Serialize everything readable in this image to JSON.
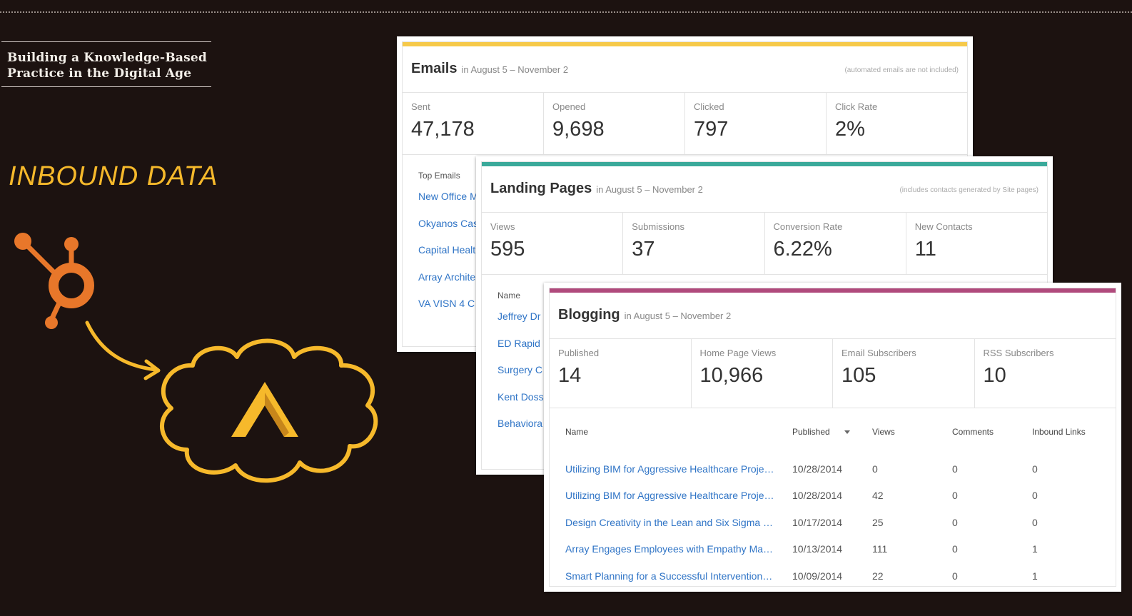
{
  "page": {
    "title_line1": "Building a Knowledge-Based",
    "title_line2": "Practice in the Digital Age",
    "heading": "INBOUND DATA"
  },
  "colors": {
    "accent_yellow": "#f6b92b",
    "hub_orange": "#e8772a",
    "emails_bar": "#f6c94a",
    "landing_bar": "#3aa99a",
    "blogging_bar": "#b04a7c",
    "link_blue": "#2f74c6"
  },
  "icons": [
    "hubspot-sprocket-icon",
    "arrow-icon",
    "cloud-icon",
    "array-logo-icon"
  ],
  "emails": {
    "title": "Emails",
    "range": "in August 5 – November 2",
    "note": "(automated emails are not included)",
    "stats": [
      {
        "label": "Sent",
        "value": "47,178"
      },
      {
        "label": "Opened",
        "value": "9,698"
      },
      {
        "label": "Clicked",
        "value": "797"
      },
      {
        "label": "Click Rate",
        "value": "2%"
      }
    ],
    "list_header": "Top Emails",
    "items": [
      "New Office M",
      "Okyanos Cas",
      "Capital Healt",
      "Array Archite",
      "VA VISN 4 C"
    ]
  },
  "landing": {
    "title": "Landing Pages",
    "range": "in August 5 – November 2",
    "note": "(includes contacts generated by Site pages)",
    "stats": [
      {
        "label": "Views",
        "value": "595"
      },
      {
        "label": "Submissions",
        "value": "37"
      },
      {
        "label": "Conversion Rate",
        "value": "6.22%"
      },
      {
        "label": "New Contacts",
        "value": "11"
      }
    ],
    "list_header": "Name",
    "items": [
      "Jeffrey Dr",
      "ED Rapid",
      "Surgery C",
      "Kent Doss",
      "Behaviora"
    ]
  },
  "blogging": {
    "title": "Blogging",
    "range": "in August 5 – November 2",
    "stats": [
      {
        "label": "Published",
        "value": "14"
      },
      {
        "label": "Home Page Views",
        "value": "10,966"
      },
      {
        "label": "Email Subscribers",
        "value": "105"
      },
      {
        "label": "RSS Subscribers",
        "value": "10"
      }
    ],
    "columns": {
      "name": "Name",
      "published": "Published",
      "views": "Views",
      "comments": "Comments",
      "links": "Inbound Links"
    },
    "rows": [
      {
        "name": "Utilizing BIM for Aggressive Healthcare Proje…",
        "published": "10/28/2014",
        "views": "0",
        "comments": "0",
        "links": "0"
      },
      {
        "name": "Utilizing BIM for Aggressive Healthcare Proje…",
        "published": "10/28/2014",
        "views": "42",
        "comments": "0",
        "links": "0"
      },
      {
        "name": "Design Creativity in the Lean and Six Sigma …",
        "published": "10/17/2014",
        "views": "25",
        "comments": "0",
        "links": "0"
      },
      {
        "name": "Array Engages Employees with Empathy Ma…",
        "published": "10/13/2014",
        "views": "111",
        "comments": "0",
        "links": "1"
      },
      {
        "name": "Smart Planning for a Successful Intervention…",
        "published": "10/09/2014",
        "views": "22",
        "comments": "0",
        "links": "1"
      }
    ]
  }
}
